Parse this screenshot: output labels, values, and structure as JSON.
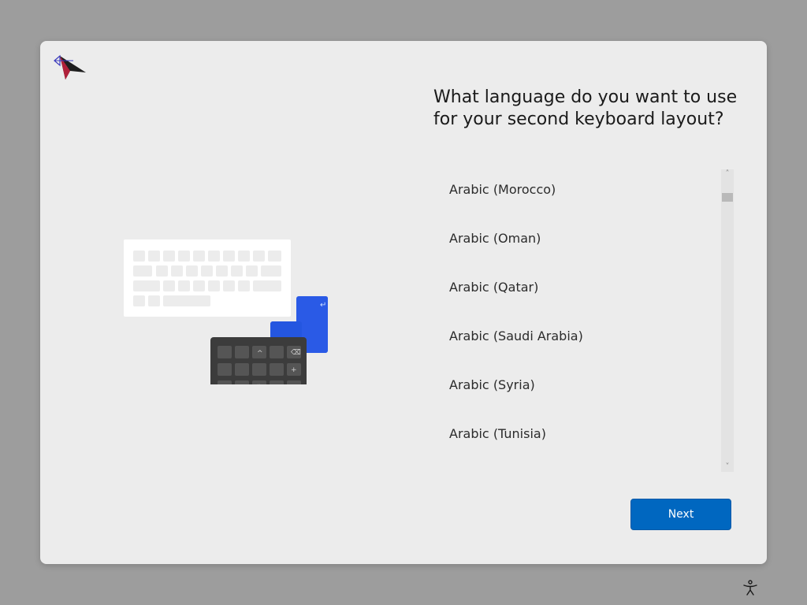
{
  "dialog": {
    "title": "What language do you want to use for your second keyboard layout?",
    "next_label": "Next"
  },
  "languages": [
    {
      "label": "Arabic (Morocco)"
    },
    {
      "label": "Arabic (Oman)"
    },
    {
      "label": "Arabic (Qatar)"
    },
    {
      "label": "Arabic (Saudi Arabia)"
    },
    {
      "label": "Arabic (Syria)"
    },
    {
      "label": "Arabic (Tunisia)"
    }
  ],
  "icons": {
    "logo": "cursor-logo-icon",
    "illustration": "keyboard-illustration-icon",
    "scroll_up": "chevron-up-icon",
    "scroll_down": "chevron-down-icon",
    "accessibility": "accessibility-icon"
  },
  "colors": {
    "background": "#9d9d9d",
    "dialog": "#ececec",
    "accent": "#0067c0",
    "keyboard_blue": "#1f4ed8",
    "numpad_dark": "#3c3c3c"
  }
}
